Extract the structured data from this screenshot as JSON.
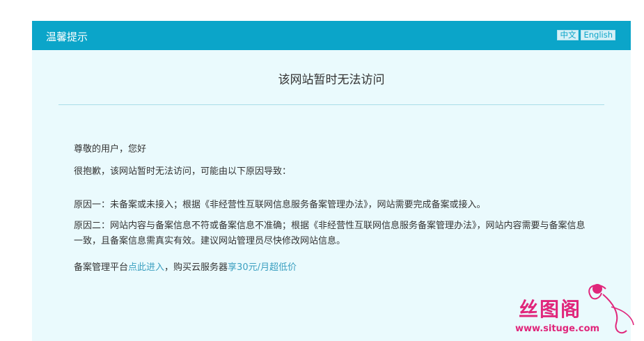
{
  "header": {
    "title": "温馨提示"
  },
  "lang": {
    "zh": "中文",
    "en": "English"
  },
  "notice": {
    "title": "该网站暂时无法访问",
    "greeting": "尊敬的用户，您好",
    "apology": "很抱歉，该网站暂时无法访问，可能由以下原因导致：",
    "reason1": "原因一：未备案或未接入；根据《非经营性互联网信息服务备案管理办法》，网站需要完成备案或接入。",
    "reason2": "原因二：网站内容与备案信息不符或备案信息不准确；根据《非经营性互联网信息服务备案管理办法》，网站内容需要与备案信息一致，且备案信息需真实有效。建议网站管理员尽快修改网站信息。",
    "footer_prefix": "备案管理平台",
    "footer_link1": "点此进入",
    "footer_middle": "，购买云服务器",
    "footer_link2": "享30元/月超低价"
  },
  "watermark": {
    "text": "丝图阁",
    "url": "www.situge.com"
  },
  "colors": {
    "header": "#0ba5c9",
    "panel": "#eafafd",
    "link": "#3a9fc0",
    "watermark": "#e0267b"
  }
}
